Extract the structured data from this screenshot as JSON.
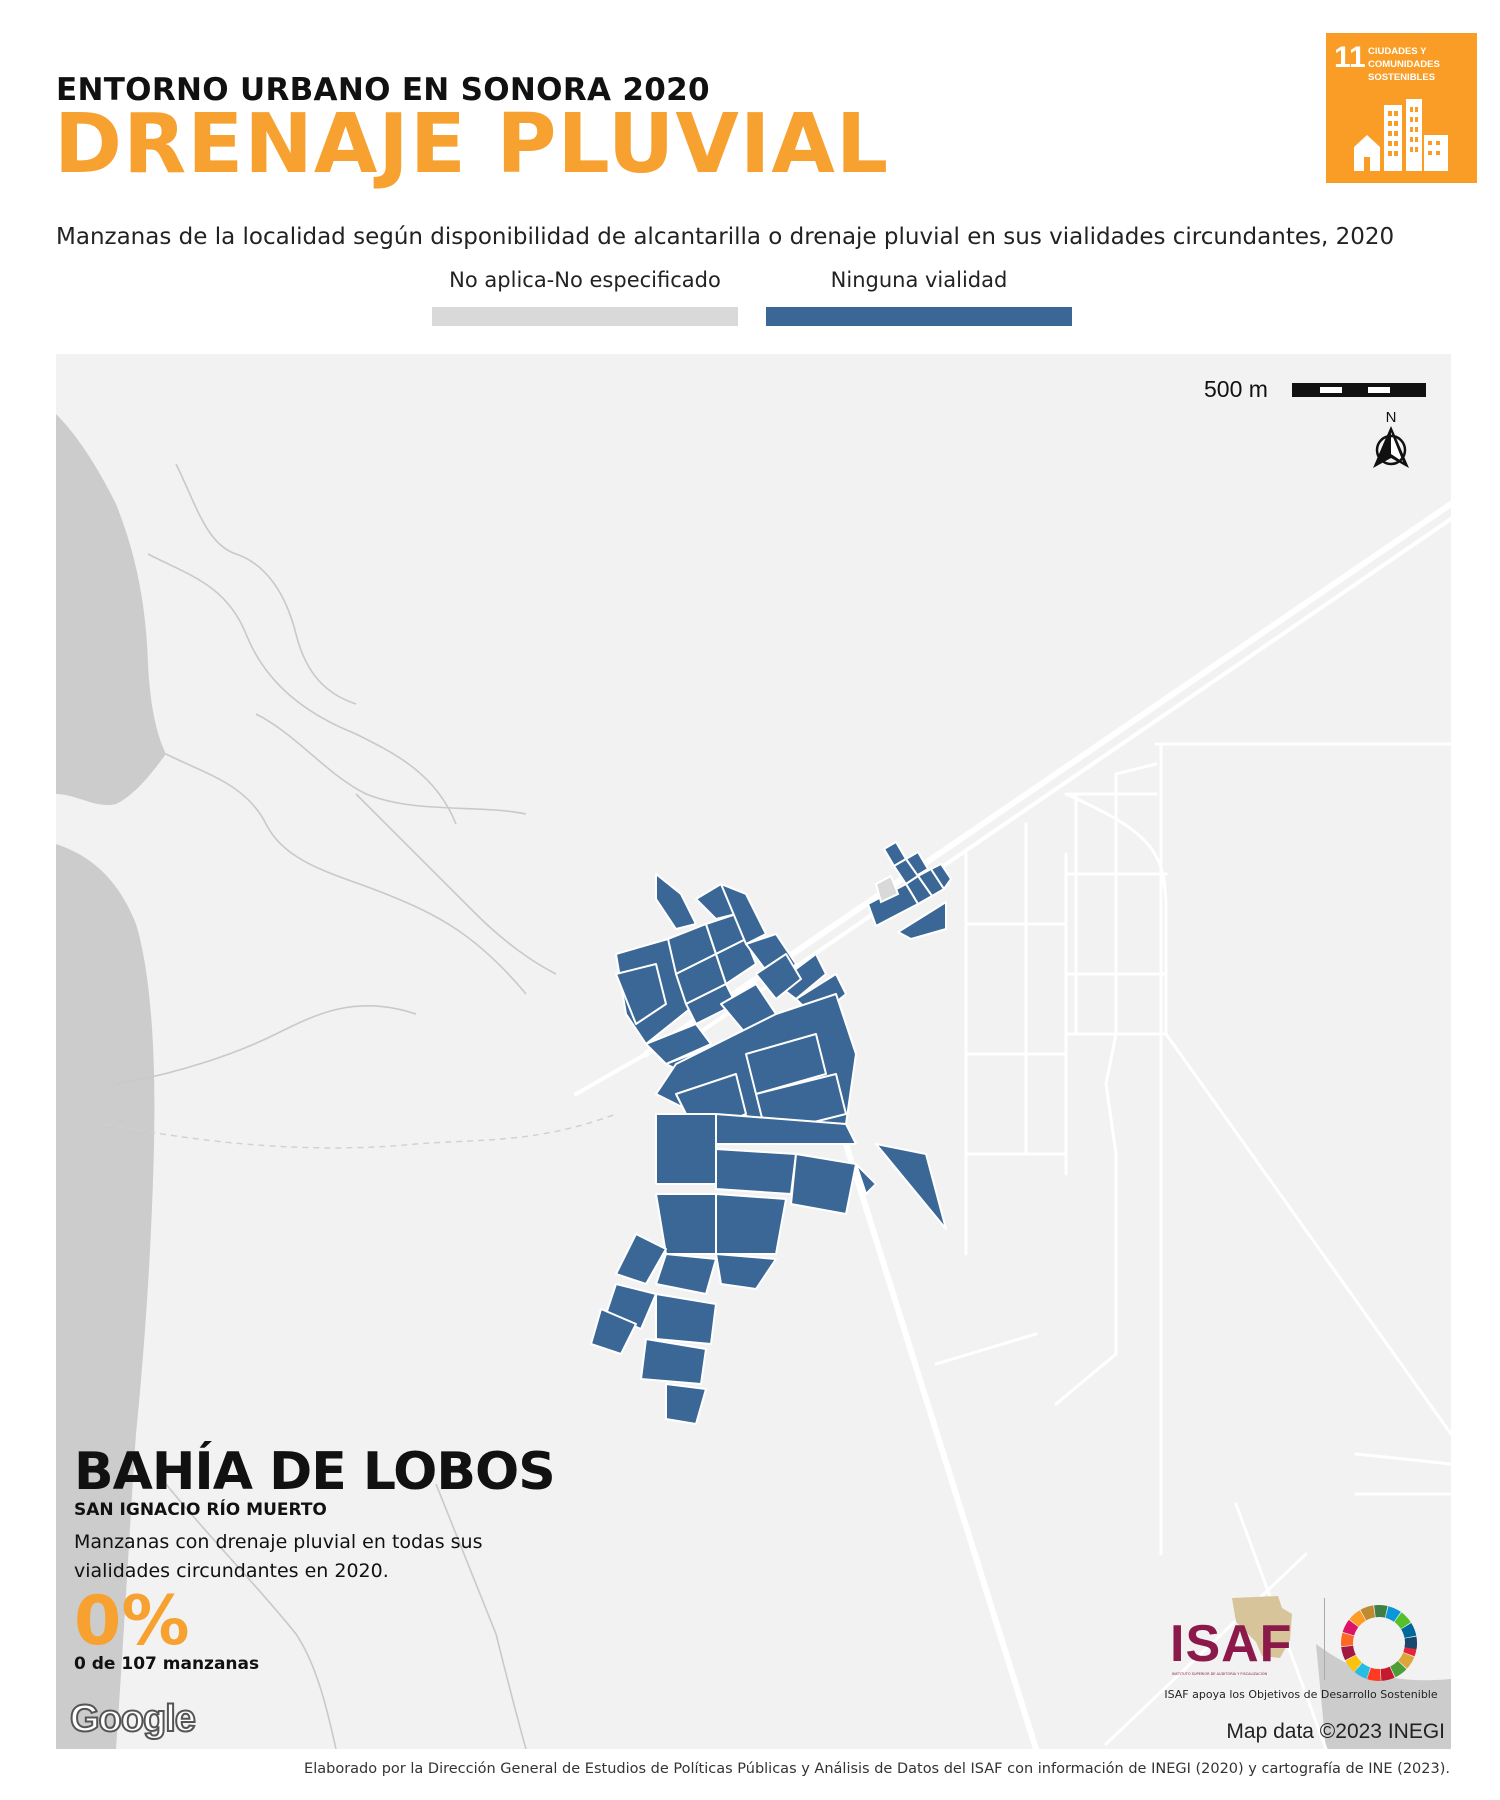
{
  "header": {
    "kicker": "ENTORNO URBANO EN SONORA 2020",
    "title": "DRENAJE PLUVIAL",
    "subtitle": "Manzanas de la localidad según disponibilidad de alcantarilla o drenaje pluvial en sus vialidades circundantes, 2020"
  },
  "sdg_badge": {
    "number": "11",
    "text": "Ciudades y comunidades sostenibles",
    "icon": "city-buildings-icon",
    "color": "#f99d26"
  },
  "legend": {
    "items": [
      {
        "label": "No aplica-No especificado",
        "color": "#d9d9d9"
      },
      {
        "label": "Ninguna vialidad",
        "color": "#3a6795"
      }
    ]
  },
  "map": {
    "scale_label": "500 m",
    "north_label": "N",
    "land_color": "#f2f2f2",
    "water_color": "#cccccc",
    "road_color": "#ffffff",
    "block_color": "#3a6795",
    "na_block_color": "#d9d9d9",
    "place_name": "BAHÍA DE LOBOS",
    "municipality": "SAN IGNACIO RÍO MUERTO",
    "stat_description": "Manzanas con drenaje pluvial en todas sus vialidades circundantes en 2020.",
    "stat_value": "0%",
    "stat_count": "0 de 107 manzanas",
    "google_label": "Google",
    "map_data": "Map data ©2023 INEGI"
  },
  "isaf": {
    "logo_text": "ISAF",
    "logo_subtext": "INSTITUTO SUPERIOR DE AUDITORÍA Y FISCALIZACIÓN",
    "tagline": "ISAF apoya los Objetivos de Desarrollo Sostenible"
  },
  "footer": {
    "text": "Elaborado por la Dirección General de Estudios de Políticas Públicas y Análisis de Datos del ISAF con información de INEGI (2020) y cartografía de INE (2023)."
  }
}
